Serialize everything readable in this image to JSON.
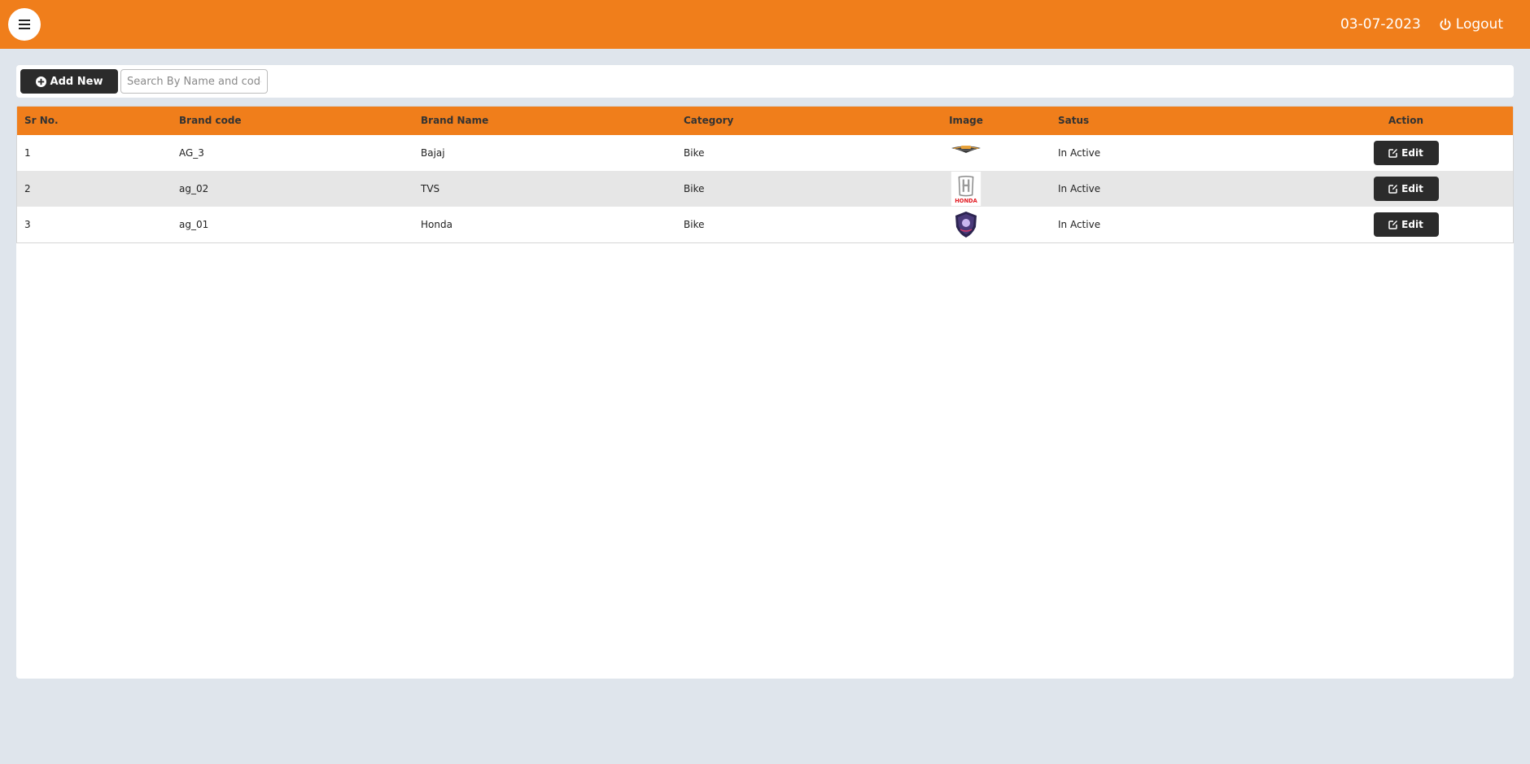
{
  "header": {
    "date": "03-07-2023",
    "logout_label": "Logout"
  },
  "toolbar": {
    "add_label": "Add New",
    "search_placeholder": "Search By Name and code"
  },
  "table": {
    "columns": [
      "Sr No.",
      "Brand code",
      "Brand Name",
      "Category",
      "Image",
      "Satus",
      "Action"
    ],
    "rows": [
      {
        "sr": "1",
        "code": "AG_3",
        "name": "Bajaj",
        "category": "Bike",
        "image": "winged-brand-logo",
        "status": "In Active",
        "action": "Edit"
      },
      {
        "sr": "2",
        "code": "ag_02",
        "name": "TVS",
        "category": "Bike",
        "image": "honda-logo",
        "status": "In Active",
        "action": "Edit"
      },
      {
        "sr": "3",
        "code": "ag_01",
        "name": "Honda",
        "category": "Bike",
        "image": "shield-crest-logo",
        "status": "In Active",
        "action": "Edit"
      }
    ]
  },
  "logo_text": {
    "row2": "HONDA"
  },
  "icons": {
    "menu": "bars-icon",
    "logout": "power-icon",
    "add": "plus-circle-icon",
    "edit": "edit-icon"
  },
  "colors": {
    "accent": "#f07e1b",
    "background": "#dfe5ec",
    "button_dark": "#2b2b2b"
  }
}
